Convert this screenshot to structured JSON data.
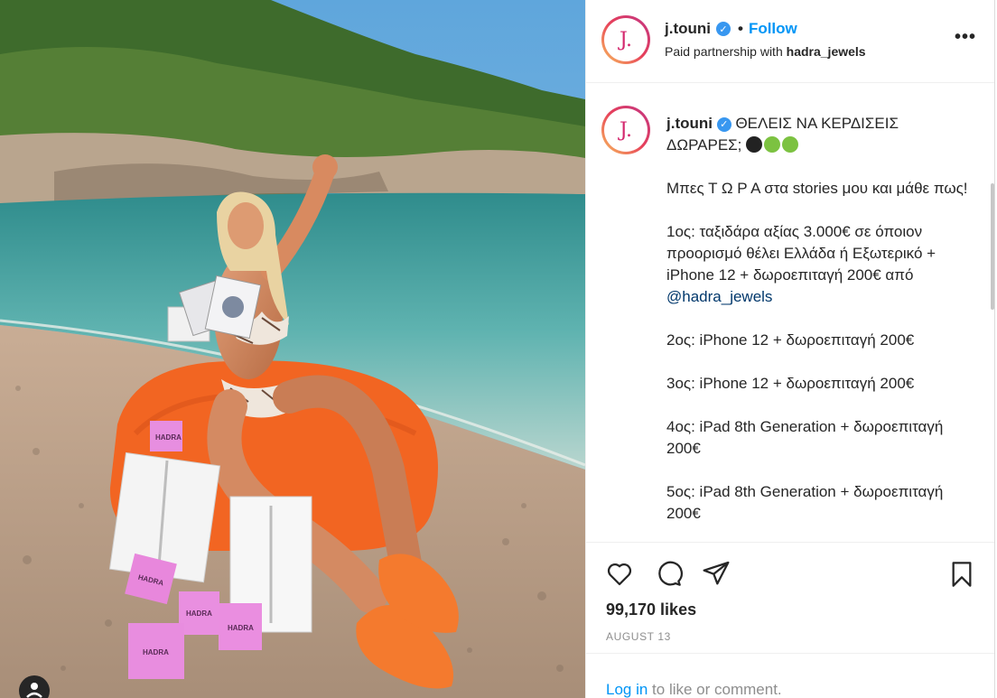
{
  "post": {
    "username": "j.touni",
    "avatar_monogram": "J.",
    "follow_label": "Follow",
    "separator": "•",
    "partnership_prefix": "Paid partnership with",
    "partner": "hadra_jewels",
    "more_label": "•••"
  },
  "caption": {
    "username": "j.touni",
    "line1": "ΘΕΛΕΙΣ ΝΑ ΚΕΡΔΙΣΕΙΣ ΔΩΡΑΡΕΣ;",
    "p2": "Μπες Τ Ω Ρ Α στα stories μου και μάθε πως!",
    "p3": "1ος: ταξιδάρα αξίας 3.000€ σε όποιον προορισμό θέλει Ελλάδα ή Εξωτερικό + iPhone 12 + δωροεπιταγή 200€ από",
    "p3_mention": "@hadra_jewels",
    "p4": "2ος: iPhone 12 + δωροεπιταγή 200€",
    "p5": "3ος: iPhone 12 + δωροεπιταγή 200€",
    "p6": "4ος: iPad 8th Generation + δωροεπιταγή 200€",
    "p7": "5ος: iPad 8th Generation + δωροεπιταγή 200€"
  },
  "photo": {
    "box_brand": "HADRA"
  },
  "engagement": {
    "likes": "99,170 likes",
    "date": "AUGUST 13",
    "login_link": "Log in",
    "login_suffix": " to like or comment."
  },
  "icons": [
    "heart-icon",
    "comment-icon",
    "share-icon",
    "bookmark-icon",
    "verified-icon"
  ],
  "colors": {
    "accent": "#0095f6",
    "verified": "#3897f0",
    "beanbag": "#f26522",
    "mention": "#00376b"
  }
}
